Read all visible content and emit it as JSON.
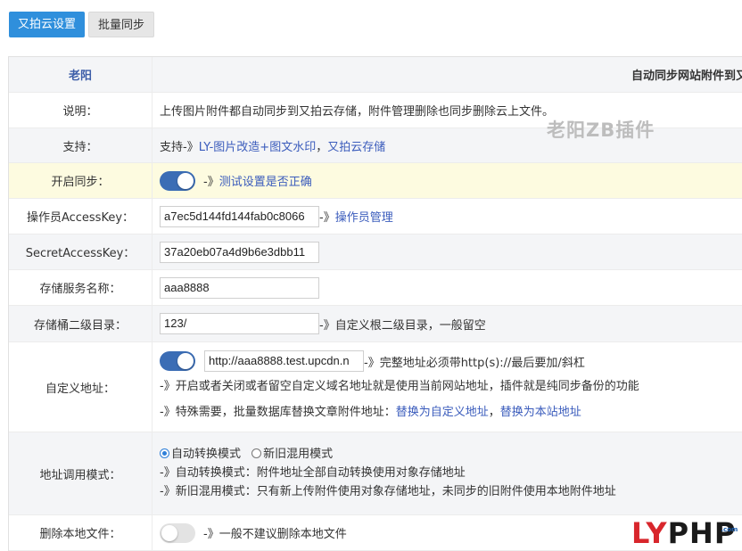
{
  "tabs": [
    {
      "label": "又拍云设置",
      "active": true
    },
    {
      "label": "批量同步",
      "active": false
    }
  ],
  "header": {
    "label": "老阳",
    "title": "自动同步网站附件到又"
  },
  "rows": {
    "desc": {
      "label": "说明：",
      "text": "上传图片附件都自动同步到又拍云存储，附件管理删除也同步删除云上文件。"
    },
    "support": {
      "label": "支持：",
      "prefix": "支持-》",
      "link1": "LY-图片改造+图文水印",
      "sep": "，",
      "link2": "又拍云存储"
    },
    "sync": {
      "label": "开启同步：",
      "enabled": true,
      "arrow": "-》",
      "link": "测试设置是否正确"
    },
    "operator": {
      "label": "操作员AccessKey：",
      "value": "a7ec5d144fd144fab0c8066",
      "arrow": "-》",
      "link": "操作员管理"
    },
    "secret": {
      "label": "SecretAccessKey：",
      "value": "37a20eb07a4d9b6e3dbb11"
    },
    "bucket": {
      "label": "存储服务名称：",
      "value": "aaa8888"
    },
    "subdir": {
      "label": "存储桶二级目录：",
      "value": "123/",
      "note": "-》自定义根二级目录，一般留空"
    },
    "custom": {
      "label": "自定义地址：",
      "enabled": true,
      "value": "http://aaa8888.test.upcdn.n",
      "note1": "-》完整地址必须带http(s)://最后要加/斜杠",
      "note2": "-》开启或者关闭或者留空自定义域名地址就是使用当前网站地址，插件就是纯同步备份的功能",
      "note3_prefix": "-》特殊需要，批量数据库替换文章附件地址：",
      "link1": "替换为自定义地址",
      "sep": "，",
      "link2": "替换为本站地址"
    },
    "mode": {
      "label": "地址调用模式：",
      "options": [
        "自动转换模式",
        "新旧混用模式"
      ],
      "selected": "自动转换模式",
      "note1": "-》自动转换模式：附件地址全部自动转换使用对象存储地址",
      "note2": "-》新旧混用模式：只有新上传附件使用对象存储地址，未同步的旧附件使用本地附件地址"
    },
    "delete": {
      "label": "删除本地文件：",
      "enabled": false,
      "note": "-》一般不建议删除本地文件"
    }
  },
  "watermark": "老阳ZB插件",
  "logo": {
    "part1": "LY",
    "part2": "PHP",
    "suffix": ".com"
  },
  "colors": {
    "accent": "#2f8fdc",
    "toggle_on": "#3b6db5",
    "link": "#3b5cbc",
    "highlight_row": "#fdfbe0"
  }
}
